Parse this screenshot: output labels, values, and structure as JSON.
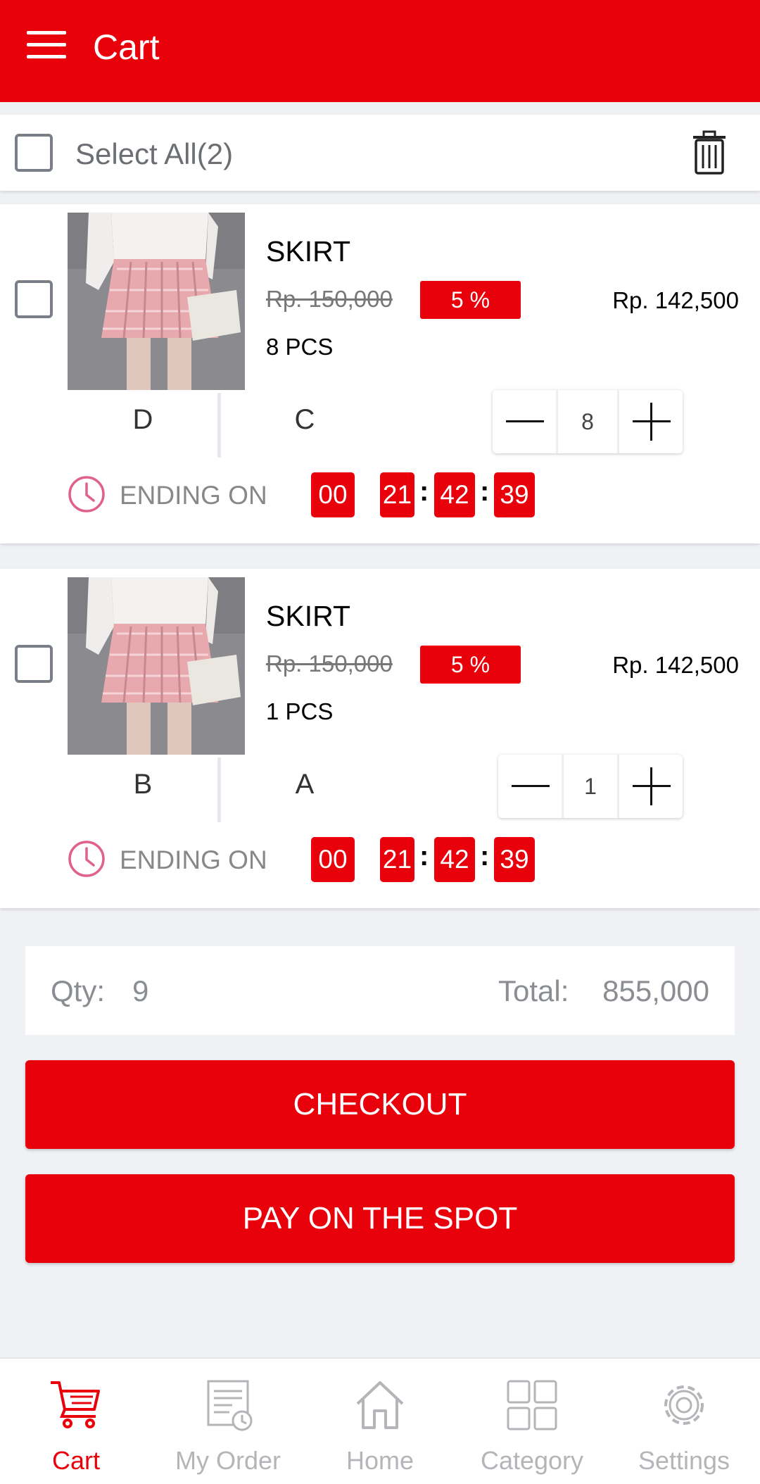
{
  "header": {
    "title": "Cart"
  },
  "select_bar": {
    "label": "Select All(2)"
  },
  "items": [
    {
      "name": "SKIRT",
      "original_price": "Rp. 150,000",
      "discount": "5 %",
      "price": "Rp. 142,500",
      "quantity_label": "8 PCS",
      "variant_1": "D",
      "variant_2": "C",
      "quantity": "8",
      "ending_label": "ENDING ON",
      "timer": {
        "days": "00",
        "hours": "21",
        "minutes": "42",
        "seconds": "39"
      }
    },
    {
      "name": "SKIRT",
      "original_price": "Rp. 150,000",
      "discount": "5 %",
      "price": "Rp. 142,500",
      "quantity_label": "1 PCS",
      "variant_1": "B",
      "variant_2": "A",
      "quantity": "1",
      "ending_label": "ENDING ON",
      "timer": {
        "days": "00",
        "hours": "21",
        "minutes": "42",
        "seconds": "39"
      }
    }
  ],
  "summary": {
    "qty_label": "Qty:",
    "qty_value": "9",
    "total_label": "Total:",
    "total_value": "855,000"
  },
  "actions": {
    "checkout": "CHECKOUT",
    "pay_on_spot": "PAY ON THE SPOT"
  },
  "tabs": [
    {
      "label": "Cart",
      "icon": "cart-icon",
      "active": true
    },
    {
      "label": "My Order",
      "icon": "order-icon",
      "active": false
    },
    {
      "label": "Home",
      "icon": "home-icon",
      "active": false
    },
    {
      "label": "Category",
      "icon": "category-icon",
      "active": false
    },
    {
      "label": "Settings",
      "icon": "settings-icon",
      "active": false
    }
  ],
  "colors": {
    "accent": "#e8000b",
    "background": "#f0f1f5",
    "inactive_tab": "#b3b5b9",
    "timer_icon": "#e0618e"
  }
}
